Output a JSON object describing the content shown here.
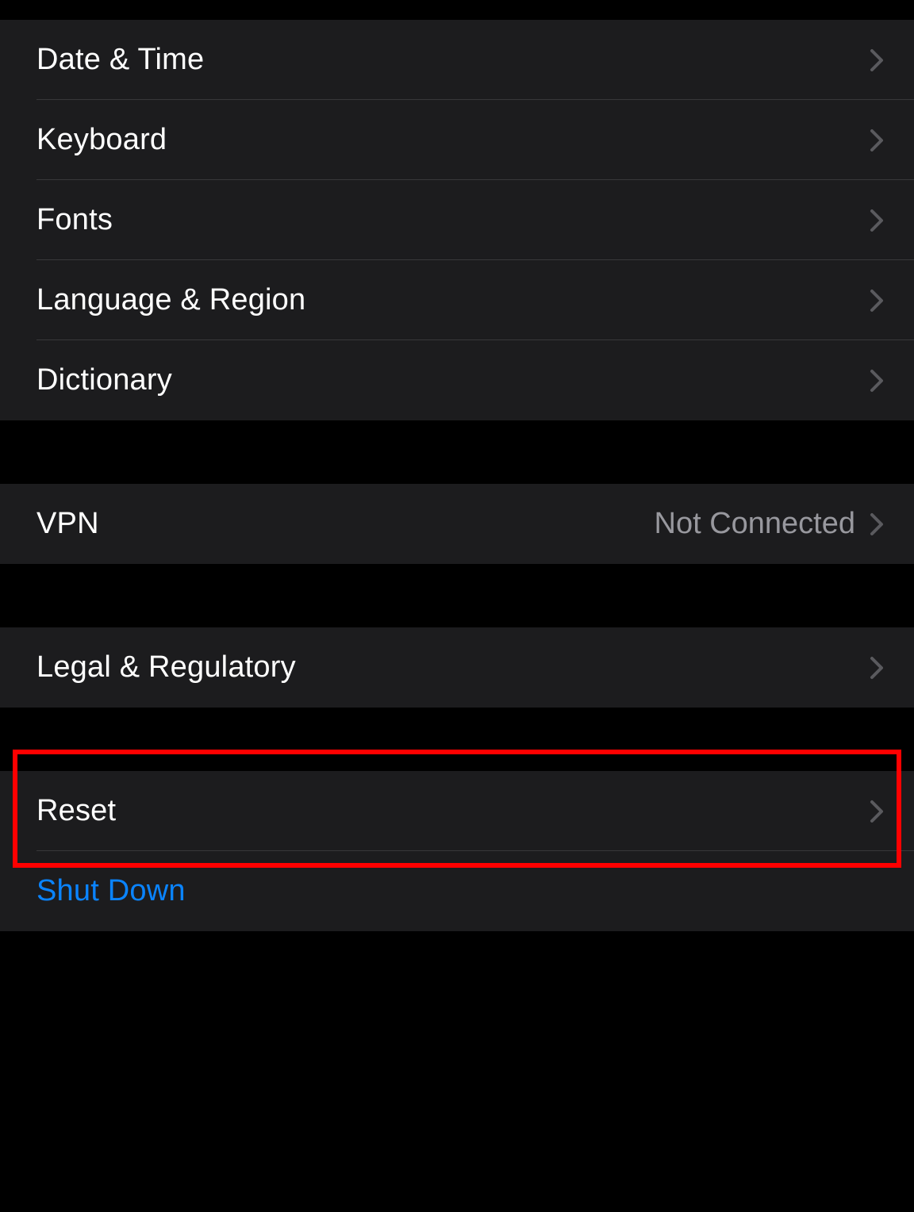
{
  "group1": {
    "items": [
      {
        "label": "Date & Time"
      },
      {
        "label": "Keyboard"
      },
      {
        "label": "Fonts"
      },
      {
        "label": "Language & Region"
      },
      {
        "label": "Dictionary"
      }
    ]
  },
  "group2": {
    "vpn": {
      "label": "VPN",
      "value": "Not Connected"
    }
  },
  "group3": {
    "legal": {
      "label": "Legal & Regulatory"
    }
  },
  "group4": {
    "reset": {
      "label": "Reset"
    },
    "shutdown": {
      "label": "Shut Down"
    }
  }
}
